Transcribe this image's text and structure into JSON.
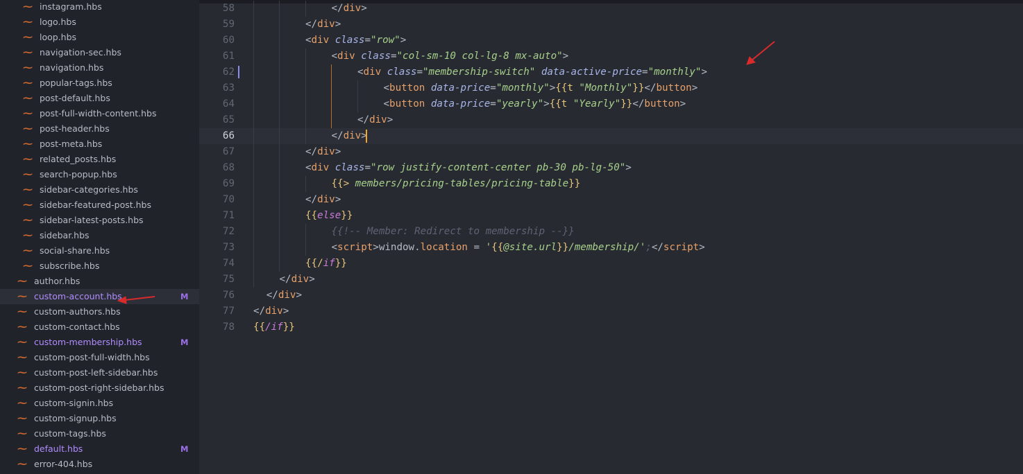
{
  "sidebar": {
    "items": [
      {
        "name": "instagram.hbs",
        "indent": 2,
        "modified": false
      },
      {
        "name": "logo.hbs",
        "indent": 2,
        "modified": false
      },
      {
        "name": "loop.hbs",
        "indent": 2,
        "modified": false
      },
      {
        "name": "navigation-sec.hbs",
        "indent": 2,
        "modified": false
      },
      {
        "name": "navigation.hbs",
        "indent": 2,
        "modified": false
      },
      {
        "name": "popular-tags.hbs",
        "indent": 2,
        "modified": false
      },
      {
        "name": "post-default.hbs",
        "indent": 2,
        "modified": false
      },
      {
        "name": "post-full-width-content.hbs",
        "indent": 2,
        "modified": false
      },
      {
        "name": "post-header.hbs",
        "indent": 2,
        "modified": false
      },
      {
        "name": "post-meta.hbs",
        "indent": 2,
        "modified": false
      },
      {
        "name": "related_posts.hbs",
        "indent": 2,
        "modified": false
      },
      {
        "name": "search-popup.hbs",
        "indent": 2,
        "modified": false
      },
      {
        "name": "sidebar-categories.hbs",
        "indent": 2,
        "modified": false
      },
      {
        "name": "sidebar-featured-post.hbs",
        "indent": 2,
        "modified": false
      },
      {
        "name": "sidebar-latest-posts.hbs",
        "indent": 2,
        "modified": false
      },
      {
        "name": "sidebar.hbs",
        "indent": 2,
        "modified": false
      },
      {
        "name": "social-share.hbs",
        "indent": 2,
        "modified": false
      },
      {
        "name": "subscribe.hbs",
        "indent": 2,
        "modified": false
      },
      {
        "name": "author.hbs",
        "indent": 1,
        "modified": false
      },
      {
        "name": "custom-account.hbs",
        "indent": 1,
        "modified": true,
        "badge": "M",
        "selected": true
      },
      {
        "name": "custom-authors.hbs",
        "indent": 1,
        "modified": false
      },
      {
        "name": "custom-contact.hbs",
        "indent": 1,
        "modified": false
      },
      {
        "name": "custom-membership.hbs",
        "indent": 1,
        "modified": true,
        "badge": "M"
      },
      {
        "name": "custom-post-full-width.hbs",
        "indent": 1,
        "modified": false
      },
      {
        "name": "custom-post-left-sidebar.hbs",
        "indent": 1,
        "modified": false
      },
      {
        "name": "custom-post-right-sidebar.hbs",
        "indent": 1,
        "modified": false
      },
      {
        "name": "custom-signin.hbs",
        "indent": 1,
        "modified": false
      },
      {
        "name": "custom-signup.hbs",
        "indent": 1,
        "modified": false
      },
      {
        "name": "custom-tags.hbs",
        "indent": 1,
        "modified": false
      },
      {
        "name": "default.hbs",
        "indent": 1,
        "modified": true,
        "badge": "M"
      },
      {
        "name": "error-404.hbs",
        "indent": 1,
        "modified": false
      }
    ],
    "file_icon": "handlebars-mustache-icon"
  },
  "editor": {
    "current_line": 66,
    "lines": [
      {
        "n": 58,
        "indent": 3,
        "tokens": [
          [
            "t-p",
            "</"
          ],
          [
            "t-tag",
            "div"
          ],
          [
            "t-p",
            ">"
          ]
        ]
      },
      {
        "n": 59,
        "indent": 2,
        "tokens": [
          [
            "t-p",
            "</"
          ],
          [
            "t-tag",
            "div"
          ],
          [
            "t-p",
            ">"
          ]
        ]
      },
      {
        "n": 60,
        "indent": 2,
        "tokens": [
          [
            "t-p",
            "<"
          ],
          [
            "t-tag",
            "div"
          ],
          [
            "t-p",
            " "
          ],
          [
            "t-attr",
            "class"
          ],
          [
            "t-eq",
            "="
          ],
          [
            "t-str",
            "\"row\""
          ],
          [
            "t-p",
            ">"
          ]
        ]
      },
      {
        "n": 61,
        "indent": 3,
        "tokens": [
          [
            "t-p",
            "<"
          ],
          [
            "t-tag",
            "div"
          ],
          [
            "t-p",
            " "
          ],
          [
            "t-attr",
            "class"
          ],
          [
            "t-eq",
            "="
          ],
          [
            "t-str",
            "\"col-sm-10 col-lg-8 mx-auto\""
          ],
          [
            "t-p",
            ">"
          ]
        ]
      },
      {
        "n": 62,
        "indent": 4,
        "mark": true,
        "tokens": [
          [
            "t-p",
            "<"
          ],
          [
            "t-tag",
            "div"
          ],
          [
            "t-p",
            " "
          ],
          [
            "t-attr",
            "class"
          ],
          [
            "t-eq",
            "="
          ],
          [
            "t-str",
            "\"membership-switch\""
          ],
          [
            "t-p",
            " "
          ],
          [
            "t-attr",
            "data-active-price"
          ],
          [
            "t-eq",
            "="
          ],
          [
            "t-str",
            "\"monthly\""
          ],
          [
            "t-p",
            ">"
          ]
        ]
      },
      {
        "n": 63,
        "indent": 5,
        "tokens": [
          [
            "t-p",
            "<"
          ],
          [
            "t-tag",
            "button"
          ],
          [
            "t-p",
            " "
          ],
          [
            "t-attr",
            "data-price"
          ],
          [
            "t-eq",
            "="
          ],
          [
            "t-str",
            "\"monthly\""
          ],
          [
            "t-p",
            ">"
          ],
          [
            "t-hb",
            "{{t "
          ],
          [
            "t-ital",
            "\"Monthly\""
          ],
          [
            "t-hb",
            "}}"
          ],
          [
            "t-p",
            "</"
          ],
          [
            "t-tag",
            "button"
          ],
          [
            "t-p",
            ">"
          ]
        ]
      },
      {
        "n": 64,
        "indent": 5,
        "tokens": [
          [
            "t-p",
            "<"
          ],
          [
            "t-tag",
            "button"
          ],
          [
            "t-p",
            " "
          ],
          [
            "t-attr",
            "data-price"
          ],
          [
            "t-eq",
            "="
          ],
          [
            "t-str",
            "\"yearly\""
          ],
          [
            "t-p",
            ">"
          ],
          [
            "t-hb",
            "{{t "
          ],
          [
            "t-ital",
            "\"Yearly\""
          ],
          [
            "t-hb",
            "}}"
          ],
          [
            "t-p",
            "</"
          ],
          [
            "t-tag",
            "button"
          ],
          [
            "t-p",
            ">"
          ]
        ]
      },
      {
        "n": 65,
        "indent": 4,
        "tokens": [
          [
            "t-p",
            "</"
          ],
          [
            "t-tag",
            "div"
          ],
          [
            "t-p",
            ">"
          ]
        ]
      },
      {
        "n": 66,
        "indent": 3,
        "tokens": [
          [
            "t-p",
            "</"
          ],
          [
            "t-tag",
            "div"
          ],
          [
            "t-p",
            ">"
          ]
        ]
      },
      {
        "n": 67,
        "indent": 2,
        "tokens": [
          [
            "t-p",
            "</"
          ],
          [
            "t-tag",
            "div"
          ],
          [
            "t-p",
            ">"
          ]
        ]
      },
      {
        "n": 68,
        "indent": 2,
        "tokens": [
          [
            "t-p",
            "<"
          ],
          [
            "t-tag",
            "div"
          ],
          [
            "t-p",
            " "
          ],
          [
            "t-attr",
            "class"
          ],
          [
            "t-eq",
            "="
          ],
          [
            "t-str",
            "\"row justify-content-center pb-30 pb-lg-50\""
          ],
          [
            "t-p",
            ">"
          ]
        ]
      },
      {
        "n": 69,
        "indent": 3,
        "tokens": [
          [
            "t-hb",
            "{{> "
          ],
          [
            "t-ital",
            "members/pricing-tables/pricing-table"
          ],
          [
            "t-hb",
            "}}"
          ]
        ]
      },
      {
        "n": 70,
        "indent": 2,
        "tokens": [
          [
            "t-p",
            "</"
          ],
          [
            "t-tag",
            "div"
          ],
          [
            "t-p",
            ">"
          ]
        ]
      },
      {
        "n": 71,
        "indent": 2,
        "tokens": [
          [
            "t-hb",
            "{{"
          ],
          [
            "t-kw",
            "else"
          ],
          [
            "t-hb",
            "}}"
          ]
        ]
      },
      {
        "n": 72,
        "indent": 3,
        "tokens": [
          [
            "t-cm",
            "{{!-- Member: Redirect to membership --}}"
          ]
        ]
      },
      {
        "n": 73,
        "indent": 3,
        "tokens": [
          [
            "t-p",
            "<"
          ],
          [
            "t-tag",
            "script"
          ],
          [
            "t-p",
            ">"
          ],
          [
            "t-txt",
            "window"
          ],
          [
            "t-dot",
            "."
          ],
          [
            "t-prop",
            "location"
          ],
          [
            "t-txt",
            " = "
          ],
          [
            "t-str",
            "'"
          ],
          [
            "t-hb",
            "{{"
          ],
          [
            "t-ital",
            "@site.url"
          ],
          [
            "t-hb",
            "}}"
          ],
          [
            "t-ital",
            "/membership/"
          ],
          [
            "t-str",
            "'"
          ],
          [
            "t-cm",
            ";"
          ],
          [
            "t-p",
            "</"
          ],
          [
            "t-tag",
            "script"
          ],
          [
            "t-p",
            ">"
          ]
        ]
      },
      {
        "n": 74,
        "indent": 2,
        "tokens": [
          [
            "t-hb",
            "{{/"
          ],
          [
            "t-kw",
            "if"
          ],
          [
            "t-hb",
            "}}"
          ]
        ]
      },
      {
        "n": 75,
        "indent": 1,
        "tokens": [
          [
            "t-p",
            "</"
          ],
          [
            "t-tag",
            "div"
          ],
          [
            "t-p",
            ">"
          ]
        ]
      },
      {
        "n": 76,
        "indent": 0.5,
        "tokens": [
          [
            "t-p",
            "</"
          ],
          [
            "t-tag",
            "div"
          ],
          [
            "t-p",
            ">"
          ]
        ]
      },
      {
        "n": 77,
        "indent": 0,
        "tokens": [
          [
            "t-p",
            "</"
          ],
          [
            "t-tag",
            "div"
          ],
          [
            "t-p",
            ">"
          ]
        ]
      },
      {
        "n": 78,
        "indent": 0,
        "tokens": [
          [
            "t-hb",
            "{{"
          ],
          [
            "t-kw",
            "/if"
          ],
          [
            "t-hb",
            "}}"
          ]
        ]
      }
    ]
  },
  "annotations": {
    "arrow_color": "#d92b2b"
  }
}
